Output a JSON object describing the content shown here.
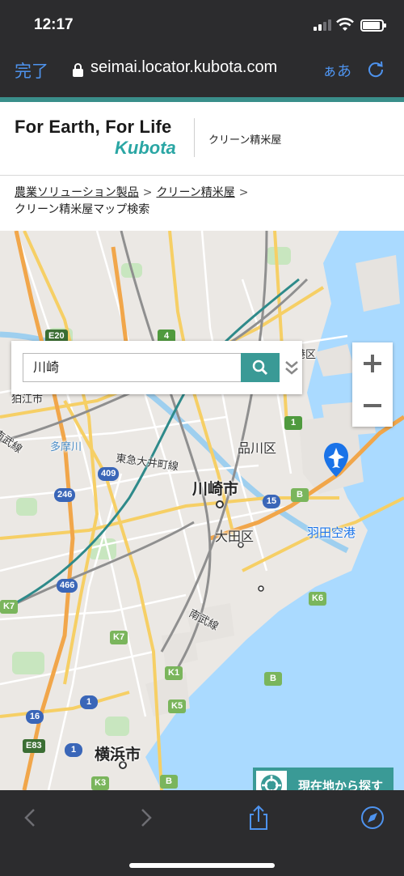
{
  "status_bar": {
    "time": "12:17"
  },
  "browser": {
    "done_label": "完了",
    "url": "seimai.locator.kubota.com",
    "text_size_label": "ぁあ"
  },
  "header": {
    "slogan": "For Earth, For Life",
    "logo": "Kubota",
    "subtitle": "クリーン精米屋"
  },
  "breadcrumb": {
    "items": [
      "農業ソリューション製品",
      "クリーン精米屋"
    ],
    "current": "クリーン精米屋マップ検索"
  },
  "search": {
    "value": "川崎"
  },
  "map": {
    "labels": {
      "kawasaki": "川崎市",
      "yokohama": "横浜市",
      "ota": "大田区",
      "shinagawa": "品川区",
      "komae": "狛江市",
      "haneda": "羽田空港",
      "tokyu_oimachi": "東急大井町線",
      "nambu_line": "南武線",
      "nambu_left": "南武線",
      "tamagawa": "多摩川",
      "minato": "港区"
    },
    "shields": {
      "e20": "E20",
      "r4": "4",
      "r1_top": "1",
      "r409": "409",
      "r246": "246",
      "r15": "15",
      "b_top": "B",
      "r466": "466",
      "k7_left": "K7",
      "k6": "K6",
      "k7": "K7",
      "k1": "K1",
      "b_mid": "B",
      "k5": "K5",
      "r1_a": "1",
      "r16": "16",
      "e83": "E83",
      "r1_b": "1",
      "k3": "K3",
      "b_low": "B"
    }
  },
  "locate": {
    "label": "現在地から探す"
  },
  "icons": {
    "lock": "lock-icon",
    "reload": "reload-icon",
    "search": "search-icon",
    "expand": "chevron-double-down-icon",
    "airport": "airplane-icon",
    "locate": "crosshair-icon",
    "back": "chevron-left-icon",
    "forward": "chevron-right-icon",
    "share": "share-icon",
    "compass": "compass-icon"
  },
  "colors": {
    "accent_teal": "#3a9a96",
    "ios_blue": "#4e93ee",
    "water": "#aadaff"
  }
}
